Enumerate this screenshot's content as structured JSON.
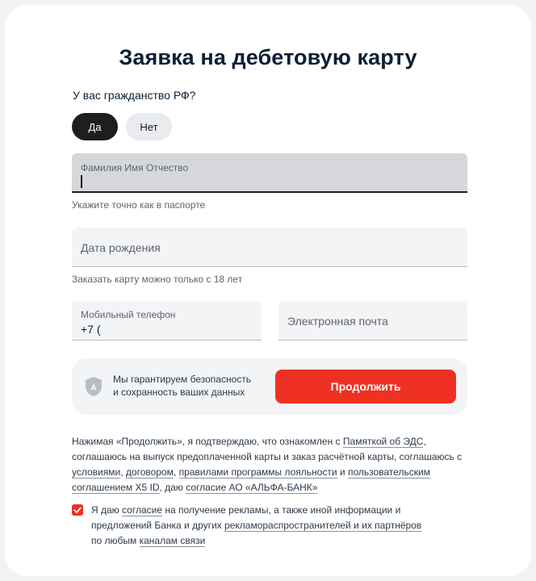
{
  "form": {
    "title": "Заявка на дебетовую карту",
    "citizenship_question": "У вас гражданство РФ?",
    "citizenship_yes": "Да",
    "citizenship_no": "Нет",
    "fio_label": "Фамилия Имя Отчество",
    "fio_hint": "Укажите точно как в паспорте",
    "dob_label": "Дата рождения",
    "dob_hint": "Заказать карту можно только с 18 лет",
    "phone_label": "Мобильный телефон",
    "phone_value": "+7 (",
    "email_label": "Электронная почта"
  },
  "security": {
    "icon": "shield-icon",
    "line1": "Мы гарантируем безопасность",
    "line2": "и сохранность ваших данных",
    "continue_label": "Продолжить"
  },
  "legal": {
    "t1": "Нажимая «Продолжить», я подтверждаю, что ознакомлен с",
    "link_eds": "Памяткой об ЭДС",
    "t2": ", соглашаюсь на выпуск предоплаченной карты и заказ расчётной карты, соглашаюсь с",
    "link_terms": "условиями",
    "sep1": ",",
    "link_contract": "договором",
    "sep2": ",",
    "link_loyalty": "правилами программы лояльности",
    "t3": "и",
    "link_x5": "пользовательским соглашением X5 ID",
    "t4": ", даю",
    "link_consent_bank": "согласие АО «АЛЬФА-БАНК»"
  },
  "consent": {
    "checked": true,
    "t1": "Я даю",
    "link_consent": "согласие",
    "t2": "на получение рекламы, а также иной информации и предложений Банка и других",
    "link_advertisers": "рекламораспространителей и их партнёров",
    "t3": "по любым",
    "link_channels": "каналам связи"
  },
  "colors": {
    "accent": "#ef3124",
    "dark": "#1e1e20",
    "field_bg": "#f3f4f5"
  }
}
